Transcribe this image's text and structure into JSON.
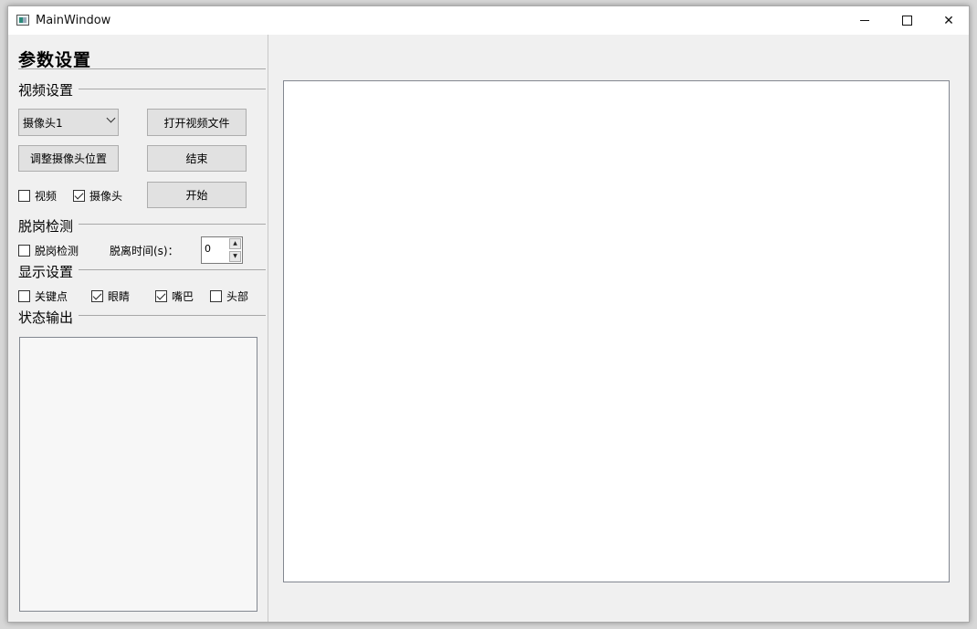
{
  "window": {
    "title": "MainWindow",
    "minimize_icon": "minimize-icon",
    "maximize_icon": "maximize-icon",
    "close_icon": "close-icon",
    "close_glyph": "✕"
  },
  "panel": {
    "heading": "参数设置",
    "video_settings": {
      "title": "视频设置",
      "camera_select": "摄像头1",
      "open_video_button": "打开视频文件",
      "adjust_camera_button": "调整摄像头位置",
      "stop_button": "结束",
      "start_button": "开始",
      "video_checkbox": {
        "label": "视频",
        "checked": false
      },
      "camera_checkbox": {
        "label": "摄像头",
        "checked": true
      }
    },
    "leave_detection": {
      "title": "脱岗检测",
      "checkbox": {
        "label": "脱岗检测",
        "checked": false
      },
      "time_label": "脱离时间(s)：",
      "time_value": "0"
    },
    "display_settings": {
      "title": "显示设置",
      "keypoints": {
        "label": "关键点",
        "checked": false
      },
      "eyes": {
        "label": "眼睛",
        "checked": true
      },
      "mouth": {
        "label": "嘴巴",
        "checked": true
      },
      "head": {
        "label": "头部",
        "checked": false
      }
    },
    "status_output": {
      "title": "状态输出",
      "text": ""
    }
  },
  "colors": {
    "window_bg": "#f0f0f0",
    "titlebar_bg": "#ffffff",
    "button_bg": "#e1e1e1",
    "border": "#adadad"
  }
}
